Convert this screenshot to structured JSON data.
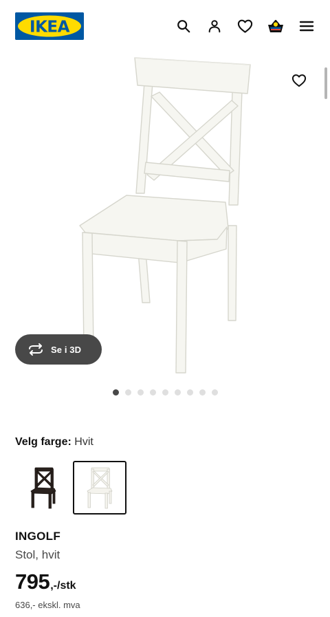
{
  "header": {
    "logo_text": "IKEA",
    "icons": [
      "search-icon",
      "account-icon",
      "wishlist-heart-icon",
      "cart-basket-icon",
      "hamburger-menu-icon"
    ]
  },
  "gallery": {
    "image_alt": "INGOLF Stol, hvit",
    "favourite_icon": "heart-outline-icon",
    "view_3d_label": "Se i 3D",
    "view_3d_icon": "rotate-3d-icon",
    "slides_total": 9,
    "active_slide": 1
  },
  "color_selector": {
    "label": "Velg farge:",
    "selected_value": "Hvit",
    "options": [
      {
        "name": "brown-black",
        "color": "#2a221e",
        "selected": false
      },
      {
        "name": "white",
        "color": "#f2f1ea",
        "selected": true
      }
    ]
  },
  "product": {
    "name": "INGOLF",
    "description": "Stol, hvit",
    "price_integer": "795",
    "price_suffix": ",-/stk",
    "price_excl_vat": "636,- ekskl. mva"
  },
  "colors": {
    "brand_blue": "#0058a3",
    "brand_yellow": "#ffdb00",
    "text_primary": "#111111",
    "text_secondary": "#484848",
    "pill_background": "#484848"
  }
}
